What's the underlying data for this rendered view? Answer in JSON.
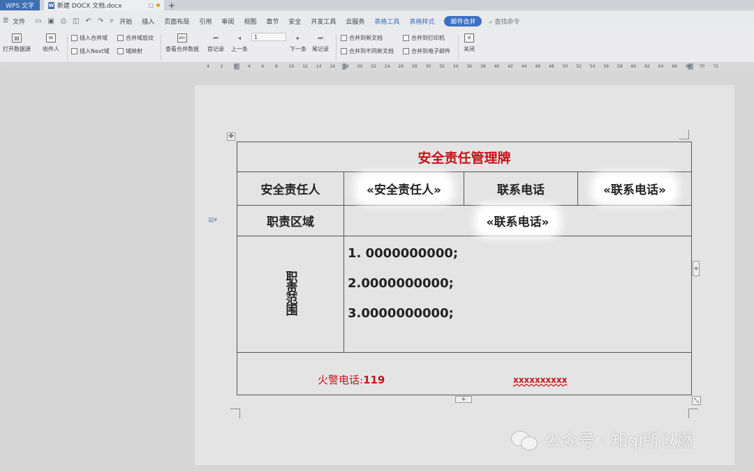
{
  "tabs": {
    "app": "WPS 文字",
    "document": "新建 DOCX 文档.docx",
    "new_tab": "+"
  },
  "menu": {
    "file": "文件",
    "items": [
      "开始",
      "插入",
      "页面布局",
      "引用",
      "审阅",
      "视图",
      "章节",
      "安全",
      "开发工具",
      "云服务"
    ],
    "table_tools": "表格工具",
    "table_style": "表格样式",
    "mail_merge": "邮件合并",
    "search": "查找命令"
  },
  "ribbon": {
    "open_source": "打开数据源",
    "recipients": "收件人",
    "insert_merge_field": "插入合并域",
    "insert_next": "插入Next域",
    "merge_field_shading": "合并域底纹",
    "field_mapping": "域映射",
    "view_merged": "查看合并数据",
    "first_record": "首记录",
    "prev": "上一条",
    "record_value": "1",
    "next": "下一条",
    "last_record": "尾记录",
    "merge_new_doc": "合并到新文档",
    "merge_diff_docs": "合并到不同新文档",
    "merge_printer": "合并到打印机",
    "merge_email": "合并到电子邮件",
    "close": "关闭"
  },
  "ruler": {
    "ticks": [
      "4",
      "2",
      "2",
      "4",
      "6",
      "8",
      "10",
      "12",
      "14",
      "16",
      "18",
      "20",
      "22",
      "24",
      "26",
      "28",
      "30",
      "32",
      "34",
      "36",
      "38",
      "40",
      "42",
      "44",
      "46",
      "48",
      "50",
      "52",
      "54",
      "56",
      "58",
      "60",
      "62",
      "64",
      "66",
      "68",
      "70",
      "72"
    ]
  },
  "table": {
    "title": "安全责任管理牌",
    "person_label": "安全责任人",
    "person_field": "«安全责任人»",
    "phone_label": "联系电话",
    "phone_field": "«联系电话»",
    "area_label": "职责区域",
    "area_field": "«联系电话»",
    "scope_label": "职责范围",
    "duties": [
      "1. 0000000000;",
      "2.0000000000;",
      "3.0000000000;"
    ],
    "fire_label": "火警电话:",
    "fire_number": "119",
    "placeholder_x": "xxxxxxxxxx"
  },
  "watermark": {
    "text": "公众号 · 知qi所以燃"
  },
  "colors": {
    "title_red": "#c4141a",
    "accent_blue": "#3d6fc4",
    "app_tab_blue": "#3f6fb3"
  }
}
